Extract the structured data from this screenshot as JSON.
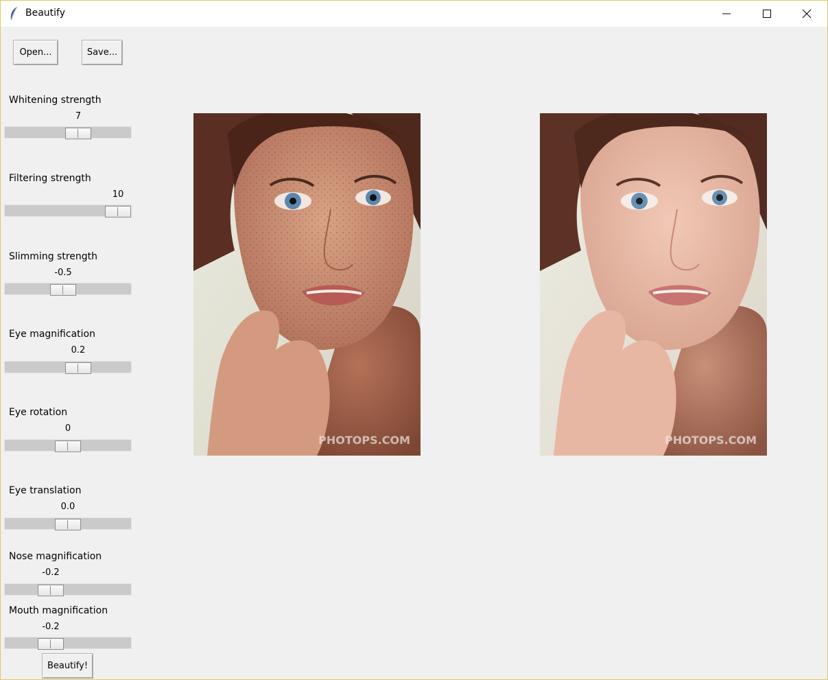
{
  "window": {
    "title": "Beautify",
    "controls": {
      "minimize": "minimize-icon",
      "maximize": "maximize-icon",
      "close": "close-icon"
    }
  },
  "toolbar": {
    "open_label": "Open...",
    "save_label": "Save..."
  },
  "sliders": [
    {
      "label": "Whitening strength",
      "value": "7",
      "level": 0.6
    },
    {
      "label": "Filtering strength",
      "value": "10",
      "level": 1.0
    },
    {
      "label": "Slimming strength",
      "value": "-0.5",
      "level": 0.45
    },
    {
      "label": "Eye magnification",
      "value": "0.2",
      "level": 0.6
    },
    {
      "label": "Eye rotation",
      "value": "0",
      "level": 0.5
    },
    {
      "label": "Eye translation",
      "value": "0.0",
      "level": 0.5
    },
    {
      "label": "Nose magnification",
      "value": "-0.2",
      "level": 0.33
    },
    {
      "label": "Mouth magnification",
      "value": "-0.2",
      "level": 0.33
    }
  ],
  "beautify_label": "Beautify!",
  "images": {
    "original": {
      "watermark": "PHOTOPS.COM"
    },
    "result": {
      "watermark": "PHOTOPS.COM"
    }
  },
  "colors": {
    "window_border": "#e3c85b",
    "background": "#f0f0f0",
    "trough": "#cacaca"
  }
}
